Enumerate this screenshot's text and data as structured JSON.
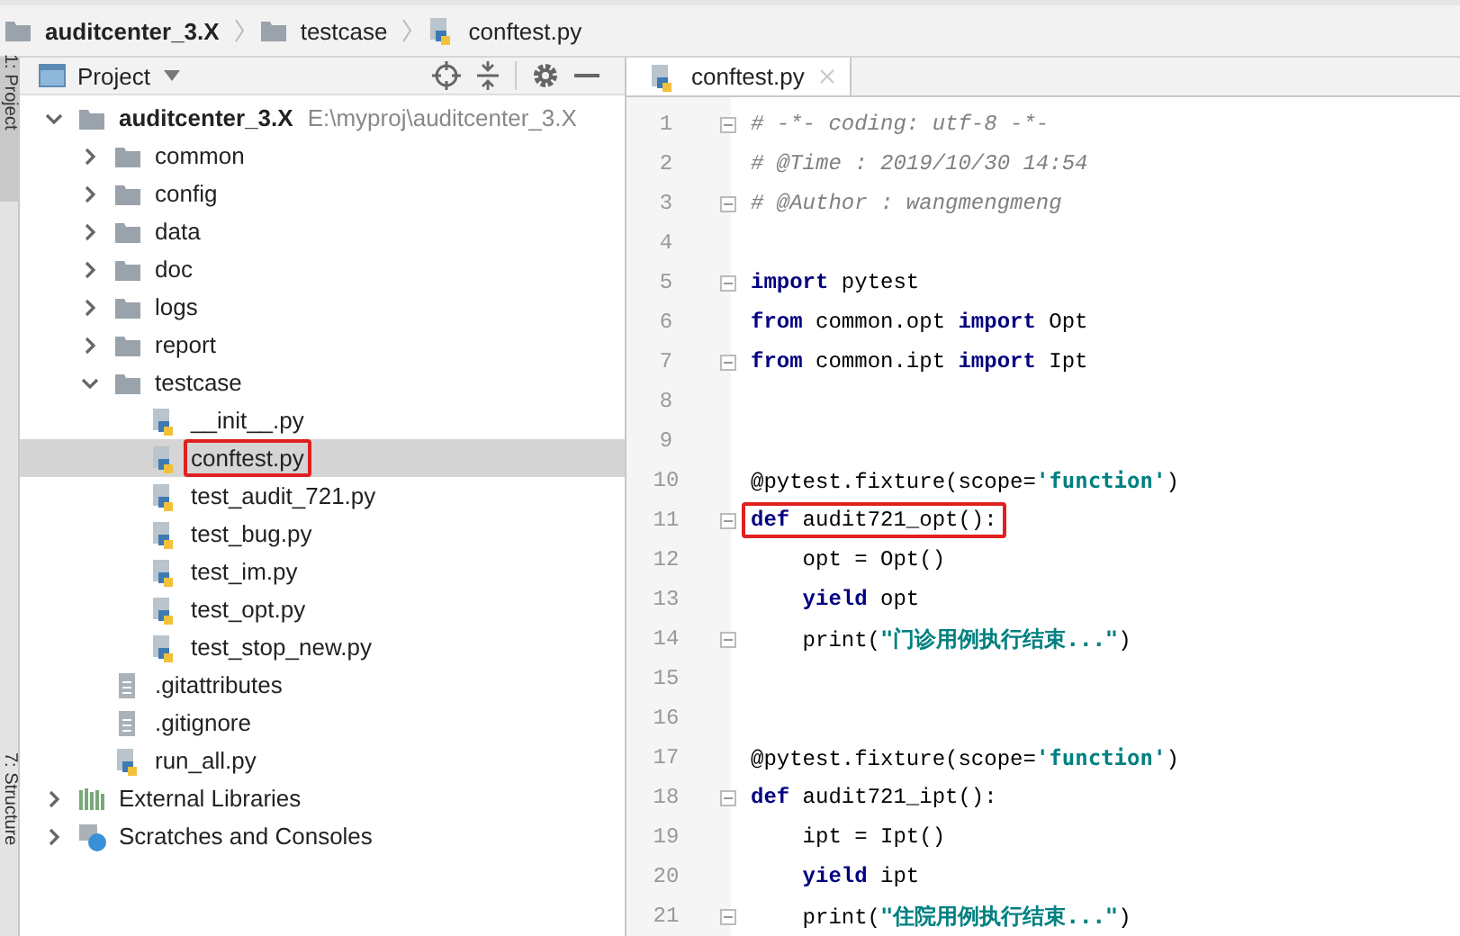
{
  "breadcrumb": [
    {
      "label": "auditcenter_3.X",
      "kind": "folder"
    },
    {
      "label": "testcase",
      "kind": "folder"
    },
    {
      "label": "conftest.py",
      "kind": "pyfile"
    }
  ],
  "side_tabs": [
    {
      "label": "1: Project",
      "selected": true
    },
    {
      "label": "7: Structure",
      "selected": false
    }
  ],
  "project_panel": {
    "title": "Project",
    "tree": [
      {
        "label": "auditcenter_3.X",
        "path": "E:\\myproj\\auditcenter_3.X",
        "kind": "folder",
        "expanded": true,
        "selected": false,
        "children": [
          {
            "label": "common",
            "kind": "folder",
            "expanded": false,
            "selected": false
          },
          {
            "label": "config",
            "kind": "folder",
            "expanded": false,
            "selected": false
          },
          {
            "label": "data",
            "kind": "folder",
            "expanded": false,
            "selected": false
          },
          {
            "label": "doc",
            "kind": "folder",
            "expanded": false,
            "selected": false
          },
          {
            "label": "logs",
            "kind": "folder",
            "expanded": false,
            "selected": false
          },
          {
            "label": "report",
            "kind": "folder",
            "expanded": false,
            "selected": false
          },
          {
            "label": "testcase",
            "kind": "folder",
            "expanded": true,
            "selected": false,
            "children": [
              {
                "label": "__init__.py",
                "kind": "pyfile",
                "selected": false
              },
              {
                "label": "conftest.py",
                "kind": "pyfile",
                "selected": true,
                "highlighted": true
              },
              {
                "label": "test_audit_721.py",
                "kind": "pyfile",
                "selected": false
              },
              {
                "label": "test_bug.py",
                "kind": "pyfile",
                "selected": false
              },
              {
                "label": "test_im.py",
                "kind": "pyfile",
                "selected": false
              },
              {
                "label": "test_opt.py",
                "kind": "pyfile",
                "selected": false
              },
              {
                "label": "test_stop_new.py",
                "kind": "pyfile",
                "selected": false
              }
            ]
          },
          {
            "label": ".gitattributes",
            "kind": "textfile",
            "selected": false
          },
          {
            "label": ".gitignore",
            "kind": "textfile",
            "selected": false
          },
          {
            "label": "run_all.py",
            "kind": "pyfile",
            "selected": false
          }
        ]
      },
      {
        "label": "External Libraries",
        "kind": "library",
        "expanded": false,
        "selected": false
      },
      {
        "label": "Scratches and Consoles",
        "kind": "scratches",
        "expanded": false,
        "selected": false
      }
    ]
  },
  "editor": {
    "tabs": [
      {
        "label": "conftest.py",
        "selected": true
      }
    ],
    "lines": [
      {
        "number": "1",
        "fold": true,
        "tokens": [
          {
            "kind": "comment",
            "text": "# -*- coding: utf-8 -*-"
          }
        ]
      },
      {
        "number": "2",
        "fold": false,
        "tokens": [
          {
            "kind": "comment",
            "text": "# @Time : 2019/10/30 14:54"
          }
        ]
      },
      {
        "number": "3",
        "fold": true,
        "tokens": [
          {
            "kind": "comment",
            "text": "# @Author : wangmengmeng"
          }
        ]
      },
      {
        "number": "4",
        "fold": false
      },
      {
        "number": "5",
        "fold": true,
        "tokens": [
          {
            "kind": "keyword",
            "text": "import"
          },
          {
            "kind": "plain",
            "text": " pytest"
          }
        ]
      },
      {
        "number": "6",
        "fold": false,
        "tokens": [
          {
            "kind": "keyword",
            "text": "from"
          },
          {
            "kind": "plain",
            "text": " common.opt "
          },
          {
            "kind": "keyword",
            "text": "import"
          },
          {
            "kind": "plain",
            "text": " Opt"
          }
        ]
      },
      {
        "number": "7",
        "fold": true,
        "tokens": [
          {
            "kind": "keyword",
            "text": "from"
          },
          {
            "kind": "plain",
            "text": " common.ipt "
          },
          {
            "kind": "keyword",
            "text": "import"
          },
          {
            "kind": "plain",
            "text": " Ipt"
          }
        ]
      },
      {
        "number": "8",
        "fold": false
      },
      {
        "number": "9",
        "fold": false
      },
      {
        "number": "10",
        "fold": false,
        "tokens": [
          {
            "kind": "plain",
            "text": "@pytest.fixture(scope="
          },
          {
            "kind": "string",
            "text": "'function'"
          },
          {
            "kind": "plain",
            "text": ")"
          }
        ]
      },
      {
        "number": "11",
        "fold": true,
        "highlighted": true,
        "tokens": [
          {
            "kind": "keyword",
            "text": "def"
          },
          {
            "kind": "plain",
            "text": " audit721_opt():"
          }
        ]
      },
      {
        "number": "12",
        "fold": false,
        "tokens": [
          {
            "kind": "plain",
            "text": "    opt = Opt()"
          }
        ]
      },
      {
        "number": "13",
        "fold": false,
        "tokens": [
          {
            "kind": "keyword",
            "text": "    yield"
          },
          {
            "kind": "plain",
            "text": " opt"
          }
        ]
      },
      {
        "number": "14",
        "fold": true,
        "tokens": [
          {
            "kind": "plain",
            "text": "    print("
          },
          {
            "kind": "string",
            "text": "\"门诊用例执行结束...\""
          },
          {
            "kind": "plain",
            "text": ")"
          }
        ]
      },
      {
        "number": "15",
        "fold": false
      },
      {
        "number": "16",
        "fold": false
      },
      {
        "number": "17",
        "fold": false,
        "tokens": [
          {
            "kind": "plain",
            "text": "@pytest.fixture(scope="
          },
          {
            "kind": "string",
            "text": "'function'"
          },
          {
            "kind": "plain",
            "text": ")"
          }
        ]
      },
      {
        "number": "18",
        "fold": true,
        "tokens": [
          {
            "kind": "keyword",
            "text": "def"
          },
          {
            "kind": "plain",
            "text": " audit721_ipt():"
          }
        ]
      },
      {
        "number": "19",
        "fold": false,
        "tokens": [
          {
            "kind": "plain",
            "text": "    ipt = Ipt()"
          }
        ]
      },
      {
        "number": "20",
        "fold": false,
        "tokens": [
          {
            "kind": "keyword",
            "text": "    yield"
          },
          {
            "kind": "plain",
            "text": " ipt"
          }
        ]
      },
      {
        "number": "21",
        "fold": true,
        "tokens": [
          {
            "kind": "plain",
            "text": "    print("
          },
          {
            "kind": "string",
            "text": "\"住院用例执行结束...\""
          },
          {
            "kind": "plain",
            "text": ")"
          }
        ]
      }
    ]
  }
}
